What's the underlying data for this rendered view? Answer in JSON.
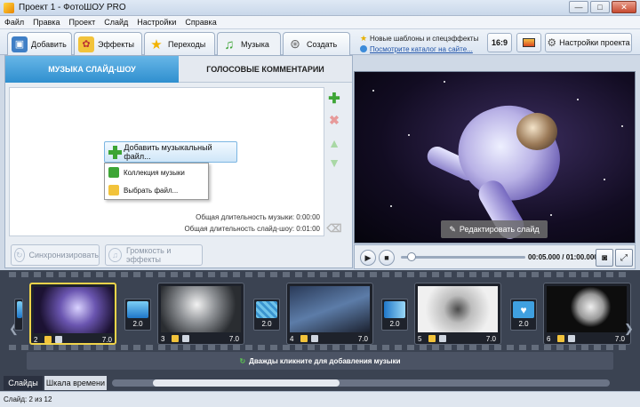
{
  "window": {
    "title": "Проект 1 - ФотоШОУ PRO",
    "minimize": "—",
    "maximize": "□",
    "close": "✕"
  },
  "menu": [
    "Файл",
    "Правка",
    "Проект",
    "Слайд",
    "Настройки",
    "Справка"
  ],
  "tabs": [
    {
      "label": "Добавить",
      "icon": "photos-icon"
    },
    {
      "label": "Эффекты",
      "icon": "palette-icon"
    },
    {
      "label": "Переходы",
      "icon": "star-icon"
    },
    {
      "label": "Музыка",
      "icon": "music-note-icon",
      "active": true
    },
    {
      "label": "Создать",
      "icon": "film-reel-icon"
    }
  ],
  "news": {
    "line1": "Новые шаблоны и спецэффекты",
    "line2": "Посмотрите каталог на сайте..."
  },
  "toolbar_right": {
    "aspect": "16:9",
    "project_settings": "Настройки проекта"
  },
  "subtabs": {
    "slideshow_music": "МУЗЫКА СЛАЙД-ШОУ",
    "voice_comments": "ГОЛОСОВЫЕ КОММЕНТАРИИ"
  },
  "music": {
    "add_button": "Добавить музыкальный файл...",
    "dropdown": [
      "Коллекция музыки",
      "Выбрать файл..."
    ],
    "total_music": "Общая длительность музыки: 0:00:00",
    "total_slideshow": "Общая длительность слайд-шоу: 0:01:00"
  },
  "buttons": {
    "sync": "Синхронизировать",
    "volume": "Громкость и эффекты",
    "edit_slide": "Редактировать слайд"
  },
  "player": {
    "timecode": "00:05.000 / 01:00.000",
    "progress": 0.083
  },
  "slides": [
    {
      "num": "2",
      "dur": "7.0",
      "selected": true
    },
    {
      "num": "3",
      "dur": "7.0"
    },
    {
      "num": "4",
      "dur": "7.0"
    },
    {
      "num": "5",
      "dur": "7.0"
    },
    {
      "num": "6",
      "dur": "7.0"
    }
  ],
  "transitions": [
    "2.0",
    "2.0",
    "2.0",
    "2.0"
  ],
  "music_hint": "Дважды кликните для добавления музыки",
  "bottom_tabs": {
    "slides": "Слайды",
    "timeline": "Шкала времени"
  },
  "status": "Слайд: 2 из 12"
}
